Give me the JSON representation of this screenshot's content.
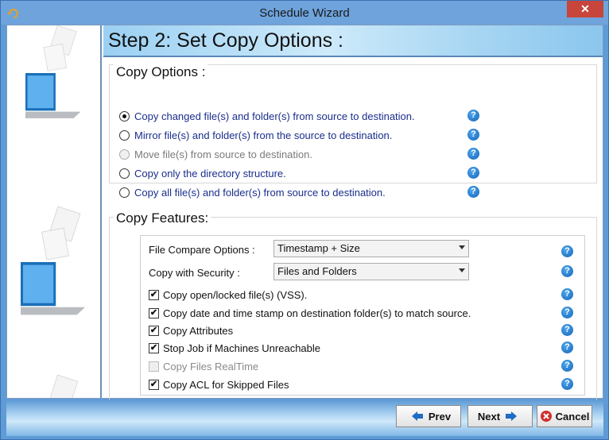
{
  "window": {
    "title": "Schedule Wizard",
    "close_glyph": "✕"
  },
  "header": {
    "title": "Step 2: Set Copy Options :"
  },
  "copy_options": {
    "title": "Copy Options :",
    "items": [
      {
        "label": "Copy changed file(s) and folder(s) from source to destination.",
        "checked": true,
        "disabled": false
      },
      {
        "label": "Mirror file(s) and folder(s) from the source to destination.",
        "checked": false,
        "disabled": false
      },
      {
        "label": "Move file(s) from source to destination.",
        "checked": false,
        "disabled": true
      },
      {
        "label": "Copy only the directory structure.",
        "checked": false,
        "disabled": false
      },
      {
        "label": "Copy all file(s) and folder(s) from source to destination.",
        "checked": false,
        "disabled": false
      }
    ]
  },
  "copy_features": {
    "title": "Copy Features:",
    "file_compare": {
      "label": "File Compare Options :",
      "value": "Timestamp + Size"
    },
    "security": {
      "label": "Copy with Security :",
      "value": "Files and Folders"
    },
    "checks": [
      {
        "label": "Copy open/locked file(s) (VSS).",
        "checked": true,
        "disabled": false
      },
      {
        "label": "Copy date and time stamp on destination folder(s) to match source.",
        "checked": true,
        "disabled": false
      },
      {
        "label": "Copy Attributes",
        "checked": true,
        "disabled": false
      },
      {
        "label": "Stop Job if Machines Unreachable",
        "checked": true,
        "disabled": false
      },
      {
        "label": "Copy Files RealTime",
        "checked": false,
        "disabled": true
      },
      {
        "label": "Copy ACL for Skipped Files",
        "checked": true,
        "disabled": false
      }
    ]
  },
  "help_glyph": "?",
  "buttons": {
    "prev": "Prev",
    "next": "Next",
    "cancel": "Cancel"
  },
  "colors": {
    "accent": "#1f6cc4",
    "header_gradient": "#9bd0f3",
    "cancel_icon": "#d12f2f"
  },
  "icons": [
    "app-icon",
    "laptop-documents-icon",
    "help-icon",
    "arrow-left-icon",
    "arrow-right-icon",
    "cancel-icon"
  ]
}
